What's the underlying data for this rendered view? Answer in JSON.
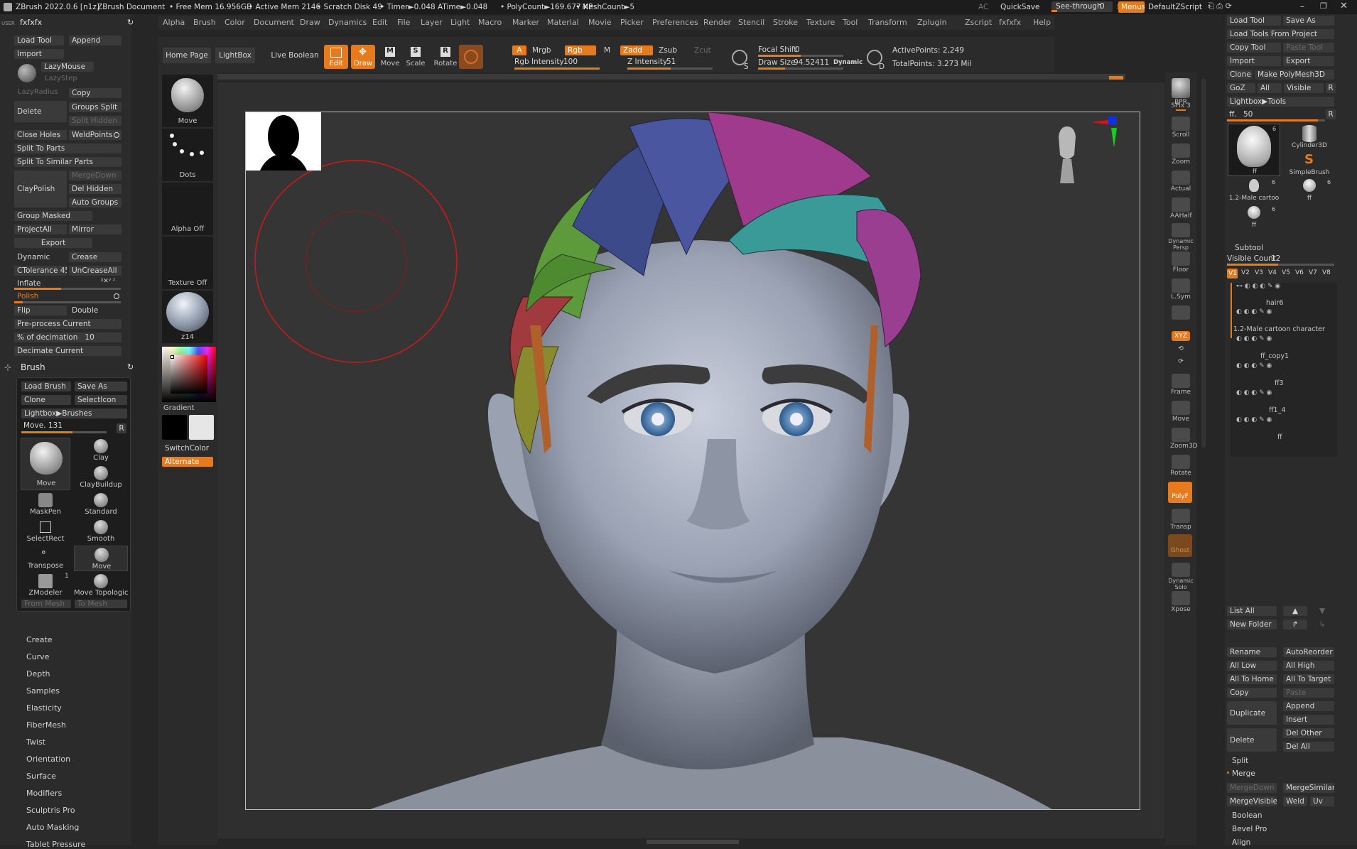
{
  "app": {
    "title": "ZBrush 2022.0.6 [n1z]",
    "doc": "ZBrush Document",
    "free_mem": "• Free Mem 16.956GB",
    "active_mem": "• Active Mem 2146",
    "scratch": "• Scratch Disk 49",
    "timer": "• Timer►0.048 ATime►0.048",
    "polycount": "• PolyCount►169.677 KP",
    "meshcount": "• MeshCount►5",
    "ac": "AC",
    "quicksave": "QuickSave",
    "seethrough": "See-through",
    "seethrough_val": "0",
    "menus": "Menus",
    "script": "DefaultZScript"
  },
  "menubar": [
    "Alpha",
    "Brush",
    "Color",
    "Document",
    "Draw",
    "Dynamics",
    "Edit",
    "File",
    "Layer",
    "Light",
    "Macro",
    "Marker",
    "Material",
    "Movie",
    "Picker",
    "Preferences",
    "Render",
    "Stencil",
    "Stroke",
    "Texture",
    "Tool",
    "Transform",
    "Zplugin",
    "Zscript",
    "fxfxfx",
    "Help"
  ],
  "shelf": {
    "home": "Home Page",
    "lightbox": "LightBox",
    "liveboolean": "Live Boolean",
    "edit": "Edit",
    "draw": "Draw",
    "move": "Move",
    "scale": "Scale",
    "rotate": "Rotate",
    "a": "A",
    "mrgb": "Mrgb",
    "rgb": "Rgb",
    "m": "M",
    "zadd": "Zadd",
    "zsub": "Zsub",
    "zcut": "Zcut",
    "rgb_int_label": "Rgb Intensity",
    "rgb_int": "100",
    "z_int_label": "Z Intensity",
    "z_int": "51",
    "focal_label": "Focal Shift",
    "focal": "0",
    "drawsize_label": "Draw Size",
    "drawsize": "94.52411",
    "dynamic": "Dynamic",
    "s": "S",
    "d": "D",
    "active_points": "ActivePoints: 2,249",
    "total_points": "TotalPoints: 3.273 Mil"
  },
  "leftpanel": {
    "user": "USER",
    "title": "fxfxfx",
    "loadtool": "Load Tool",
    "append": "Append",
    "import": "Import",
    "lazymouse": "LazyMouse",
    "lazystep": "LazyStep",
    "lazyradius": "LazyRadius",
    "copy": "Copy",
    "delete": "Delete",
    "groupssplit": "Groups Split",
    "splithidden": "Split Hidden",
    "closeholes": "Close Holes",
    "weldpoints": "WeldPoints",
    "splittoparts": "Split To Parts",
    "splitsimilar": "Split To Similar Parts",
    "claypolish": "ClayPolish",
    "mergedown": "MergeDown",
    "delhidden": "Del Hidden",
    "autogroups": "Auto Groups",
    "groupmasked": "Group Masked",
    "projectall": "ProjectAll",
    "mirror": "Mirror",
    "export": "Export",
    "dynamic": "Dynamic",
    "crease": "Crease",
    "ctolerance": "CTolerance",
    "ctolerance_val": "45",
    "uncreaseall": "UnCreaseAll",
    "inflate": "Inflate",
    "inflate_icons": "ᵡ✕ᵞ ᶻ",
    "polish": "Polish",
    "flip": "Flip",
    "double": "Double",
    "preprocess": "Pre-process Current",
    "pctdec": "% of decimation",
    "pctdec_val": "10",
    "decimate": "Decimate Current",
    "brush": "Brush",
    "loadbrush": "Load Brush",
    "saveas": "Save As",
    "clone": "Clone",
    "selecticon": "SelectIcon",
    "lightboxbrushes": "Lightbox▶Brushes",
    "move_val": "Move. 131",
    "r": "R",
    "brushes": [
      "Move",
      "Clay",
      "ClayBuildup",
      "MaskPen",
      "Standard",
      "SelectRect",
      "Smooth",
      "Transpose",
      "Move",
      "ZModeler",
      "Move Topologic"
    ],
    "zmodeler_count": "1",
    "frommesh": "From Mesh",
    "tomesh": "To Mesh",
    "menus": [
      "Create",
      "Curve",
      "Depth",
      "Samples",
      "Elasticity",
      "FiberMesh",
      "Twist",
      "Orientation",
      "Surface",
      "Modifiers",
      "Sculptris Pro",
      "Auto Masking",
      "Tablet Pressure"
    ]
  },
  "leftshelf": {
    "move": "Move",
    "dots": "Dots",
    "alpha": "Alpha Off",
    "texture": "Texture Off",
    "material": "z14",
    "gradient": "Gradient",
    "switchcolor": "SwitchColor",
    "alternate": "Alternate"
  },
  "rightshelf": [
    "BPR",
    "SPix 3",
    "Scroll",
    "Zoom",
    "Actual",
    "AAHalf",
    "Dynamic Persp",
    "Floor",
    "L.Sym",
    "",
    "XYZ",
    "",
    "",
    "Frame",
    "Move",
    "Zoom3D",
    "Rotate",
    "PolyF",
    "Transp",
    "Ghost",
    "Dynamic Solo",
    "Xpose"
  ],
  "rightpanel": {
    "loadtool": "Load Tool",
    "saveas": "Save As",
    "loadfromproject": "Load Tools From Project",
    "copytool": "Copy Tool",
    "pastetool": "Paste Tool",
    "import": "Import",
    "export": "Export",
    "clone": "Clone",
    "makepolymesh": "Make PolyMesh3D",
    "goz": "GoZ",
    "all": "All",
    "visible": "Visible",
    "r": "R",
    "lightboxtools": "Lightbox▶Tools",
    "ff_label": "ff.",
    "ff_val": "50",
    "tools": [
      "ff",
      "Cylinder3D",
      "SimpleBrush",
      "1.2-Male cartoo",
      "ff",
      "ff"
    ],
    "tool_counts": [
      "6",
      "6",
      "6",
      "6"
    ],
    "subtool": "Subtool",
    "visiblecount": "Visible Count",
    "visiblecount_val": "12",
    "versions": [
      "V1",
      "V2",
      "V3",
      "V4",
      "V5",
      "V6",
      "V7",
      "V8"
    ],
    "subtools": [
      "hair6",
      "1.2-Male cartoon character",
      "ff_copy1",
      "ff3",
      "ff1_4",
      "ff"
    ],
    "listall": "List All",
    "newfolder": "New Folder",
    "rename": "Rename",
    "autoreorder": "AutoReorder",
    "alllow": "All Low",
    "allhigh": "All High",
    "alltohome": "All To Home",
    "alltotarget": "All To Target",
    "copy": "Copy",
    "paste": "Paste",
    "duplicate": "Duplicate",
    "append": "Append",
    "insert": "Insert",
    "delete": "Delete",
    "delother": "Del Other",
    "delall": "Del All",
    "split": "Split",
    "merge": "Merge",
    "mergedown": "MergeDown",
    "mergesimilar": "MergeSimilar",
    "mergevisible": "MergeVisible",
    "weld": "Weld",
    "uv": "Uv",
    "boolean": "Boolean",
    "bevelpro": "Bevel Pro",
    "align": "Align"
  }
}
